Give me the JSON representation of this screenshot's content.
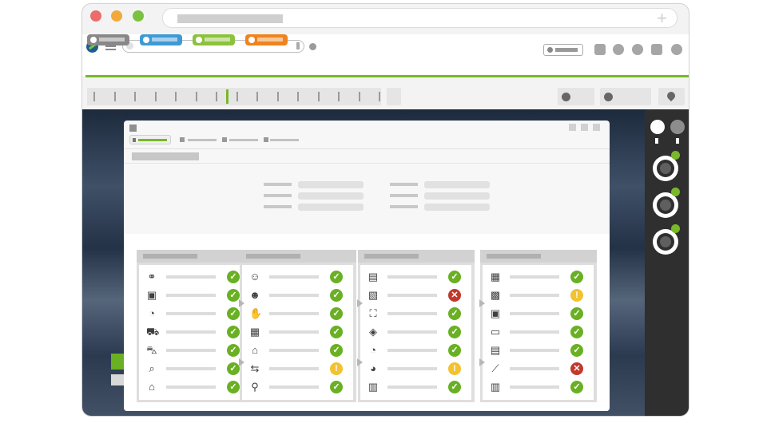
{
  "colors": {
    "accent_green": "#78b829",
    "tab_gray": "#888888",
    "tab_blue": "#3e9ad6",
    "tab_green": "#8cc33c",
    "tab_orange": "#f0831e",
    "traffic_red": "#ec6b6b",
    "traffic_yellow": "#f2a93b",
    "traffic_green": "#7cc242",
    "status_ok": "#6ab023",
    "status_error": "#c0392b",
    "status_warning": "#f2c230"
  },
  "app_tabs": [
    {
      "color": "#888888"
    },
    {
      "color": "#3e9ad6"
    },
    {
      "color": "#8cc33c"
    },
    {
      "color": "#f0831e"
    }
  ],
  "columns": [
    {
      "rows": [
        {
          "icon": "people-tree-icon",
          "glyph": "⚭",
          "status": "ok"
        },
        {
          "icon": "box-icon",
          "glyph": "▣",
          "status": "ok"
        },
        {
          "icon": "clock-icon",
          "glyph": "◔",
          "status": "ok"
        },
        {
          "icon": "forklift-icon",
          "glyph": "⛟",
          "status": "ok"
        },
        {
          "icon": "cart-icon",
          "glyph": "⛍",
          "status": "ok"
        },
        {
          "icon": "inspect-icon",
          "glyph": "⌕",
          "status": "ok"
        },
        {
          "icon": "store-icon",
          "glyph": "⌂",
          "status": "ok"
        }
      ]
    },
    {
      "rows": [
        {
          "icon": "chat-person-icon",
          "glyph": "☺",
          "status": "ok"
        },
        {
          "icon": "worker-icon",
          "glyph": "☻",
          "status": "ok"
        },
        {
          "icon": "hand-icon",
          "glyph": "✋",
          "status": "ok"
        },
        {
          "icon": "warehouse-icon",
          "glyph": "▦",
          "status": "ok"
        },
        {
          "icon": "house-icon",
          "glyph": "⌂",
          "status": "ok"
        },
        {
          "icon": "route-icon",
          "glyph": "⇆",
          "status": "warning"
        },
        {
          "icon": "search-icon",
          "glyph": "⚲",
          "status": "ok"
        }
      ]
    },
    {
      "rows": [
        {
          "icon": "layout-icon",
          "glyph": "▤",
          "status": "ok"
        },
        {
          "icon": "settings-window-icon",
          "glyph": "▧",
          "status": "error"
        },
        {
          "icon": "hand-truck-icon",
          "glyph": "⛶",
          "status": "ok"
        },
        {
          "icon": "package-hand-icon",
          "glyph": "◈",
          "status": "ok"
        },
        {
          "icon": "clock-icon",
          "glyph": "◔",
          "status": "ok"
        },
        {
          "icon": "pie-chart-icon",
          "glyph": "◕",
          "status": "warning"
        },
        {
          "icon": "bar-chart-icon",
          "glyph": "▥",
          "status": "ok"
        }
      ]
    },
    {
      "rows": [
        {
          "icon": "table-icon",
          "glyph": "▦",
          "status": "ok"
        },
        {
          "icon": "grid-calendar-icon",
          "glyph": "▩",
          "status": "warning"
        },
        {
          "icon": "box-icon",
          "glyph": "▣",
          "status": "ok"
        },
        {
          "icon": "monitor-icon",
          "glyph": "▭",
          "status": "ok"
        },
        {
          "icon": "calendar-icon",
          "glyph": "▤",
          "status": "ok"
        },
        {
          "icon": "line-chart-icon",
          "glyph": "⟋",
          "status": "error"
        },
        {
          "icon": "bar-chart-icon",
          "glyph": "▥",
          "status": "ok"
        }
      ]
    }
  ],
  "status_glyphs": {
    "ok": "✓",
    "error": "✕",
    "warning": "!"
  }
}
